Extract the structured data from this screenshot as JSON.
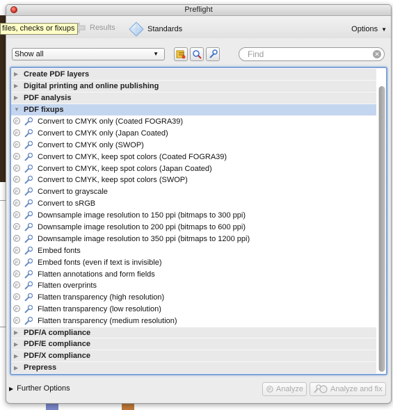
{
  "window": {
    "title": "Preflight"
  },
  "toolbar": {
    "tooltip": "files, checks or fixups",
    "tabs": [
      {
        "label": "Results",
        "icon": "results-arrow-icon"
      },
      {
        "label": "Standards",
        "icon": "standards-diamond-icon"
      }
    ],
    "options_label": "Options"
  },
  "filter": {
    "select_value": "Show all",
    "find_placeholder": "Find",
    "buttons": [
      "profiles-icon",
      "checks-icon",
      "fixups-icon"
    ]
  },
  "list": {
    "categories_before": [
      {
        "label": "Create PDF layers",
        "expanded": false
      },
      {
        "label": "Digital printing and online publishing",
        "expanded": false
      },
      {
        "label": "PDF analysis",
        "expanded": false
      }
    ],
    "open_category": {
      "label": "PDF fixups",
      "expanded": true
    },
    "fixups": [
      "Convert to CMYK only (Coated FOGRA39)",
      "Convert to CMYK only (Japan Coated)",
      "Convert to CMYK only (SWOP)",
      "Convert to CMYK, keep spot colors (Coated FOGRA39)",
      "Convert to CMYK, keep spot colors (Japan Coated)",
      "Convert to CMYK, keep spot colors (SWOP)",
      "Convert to grayscale",
      "Convert to sRGB",
      "Downsample image resolution to 150 ppi (bitmaps to 300 ppi)",
      "Downsample image resolution to 200 ppi (bitmaps to 600 ppi)",
      "Downsample image resolution to 350 ppi (bitmaps to 1200 ppi)",
      "Embed fonts",
      "Embed fonts (even if text is invisible)",
      "Flatten annotations and form fields",
      "Flatten overprints",
      "Flatten transparency (high resolution)",
      "Flatten transparency (low resolution)",
      "Flatten transparency (medium resolution)"
    ],
    "categories_after": [
      {
        "label": "PDF/A compliance",
        "expanded": false
      },
      {
        "label": "PDF/E compliance",
        "expanded": false
      },
      {
        "label": "PDF/X compliance",
        "expanded": false
      },
      {
        "label": "Prepress",
        "expanded": false
      }
    ]
  },
  "bottom": {
    "further_options": "Further Options",
    "analyze_label": "Analyze",
    "analyze_fix_label": "Analyze and fix"
  },
  "colors": {
    "selected_row": "#c4d6ef",
    "list_focus_border": "#7fa3d8",
    "tooltip_bg": "#fefec6"
  }
}
